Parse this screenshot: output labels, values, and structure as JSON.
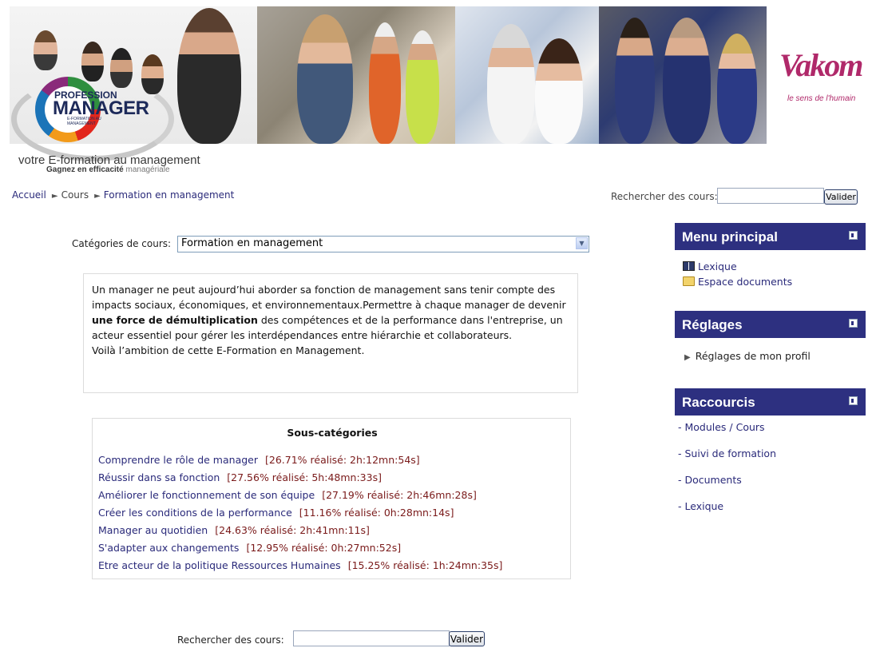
{
  "header": {
    "logo_line1": "PROFESSION",
    "logo_line2": "MANAGER",
    "logo_sub": "E-FORMATION AU MANAGEMENT",
    "tagline_main": "votre E-formation au management",
    "tagline_sub_bold": "Gagnez en efficacité",
    "tagline_sub_rest": "managériale",
    "vakom_logo": "Vakom",
    "vakom_slogan": "le sens de l'humain"
  },
  "breadcrumb": {
    "home": "Accueil",
    "courses": "Cours",
    "current": "Formation en management",
    "separator": "►"
  },
  "top_search": {
    "label": "Rechercher des cours:",
    "value": "",
    "button": "Valider"
  },
  "category_select": {
    "label": "Catégories de cours:",
    "selected": "Formation en management"
  },
  "description": {
    "part1": "Un manager ne peut aujourd’hui aborder sa fonction de management sans tenir compte des impacts sociaux, économiques, et environnementaux.Permettre à chaque manager de devenir ",
    "bold": "une force de démultiplication",
    "part2": " des compétences et de la performance dans l'entreprise, un acteur essentiel pour gérer les interdépendances entre hiérarchie et collaborateurs.",
    "line_last": "Voilà l’ambition de cette E-Formation en Management."
  },
  "subcategories": {
    "title": "Sous-catégories",
    "items": [
      {
        "label": "Comprendre le rôle de manager",
        "stat": "[26.71% réalisé: 2h:12mn:54s]"
      },
      {
        "label": "Réussir dans sa fonction",
        "stat": "[27.56% réalisé: 5h:48mn:33s]"
      },
      {
        "label": "Améliorer le fonctionnement de son équipe",
        "stat": "[27.19% réalisé: 2h:46mn:28s]"
      },
      {
        "label": "Créer les conditions de la performance",
        "stat": "[11.16% réalisé: 0h:28mn:14s]"
      },
      {
        "label": "Manager au quotidien",
        "stat": "[24.63% réalisé: 2h:41mn:11s]"
      },
      {
        "label": "S'adapter aux changements",
        "stat": "[12.95% réalisé: 0h:27mn:52s]"
      },
      {
        "label": "Etre acteur de la politique Ressources Humaines",
        "stat": "[15.25% réalisé: 1h:24mn:35s]"
      }
    ]
  },
  "bottom_search": {
    "label": "Rechercher des cours:",
    "value": "",
    "button": "Valider"
  },
  "menu_principal": {
    "title": "Menu principal",
    "items": [
      {
        "label": "Lexique",
        "icon": "book-icon"
      },
      {
        "label": "Espace documents",
        "icon": "folder-icon"
      }
    ]
  },
  "reglages": {
    "title": "Réglages",
    "items": [
      {
        "label": "Réglages de mon profil",
        "icon": "triangle-right-icon"
      }
    ]
  },
  "raccourcis": {
    "title": "Raccourcis",
    "prefix": "- ",
    "items": [
      {
        "label": "Modules / Cours"
      },
      {
        "label": "Suivi de formation"
      },
      {
        "label": "Documents"
      },
      {
        "label": "Lexique"
      }
    ]
  },
  "colors": {
    "block_header": "#2d3080",
    "link": "#2a2a7a",
    "stat": "#7a1a1a",
    "vakom_blue": "#243a93",
    "vakom_pink": "#b0296a"
  }
}
